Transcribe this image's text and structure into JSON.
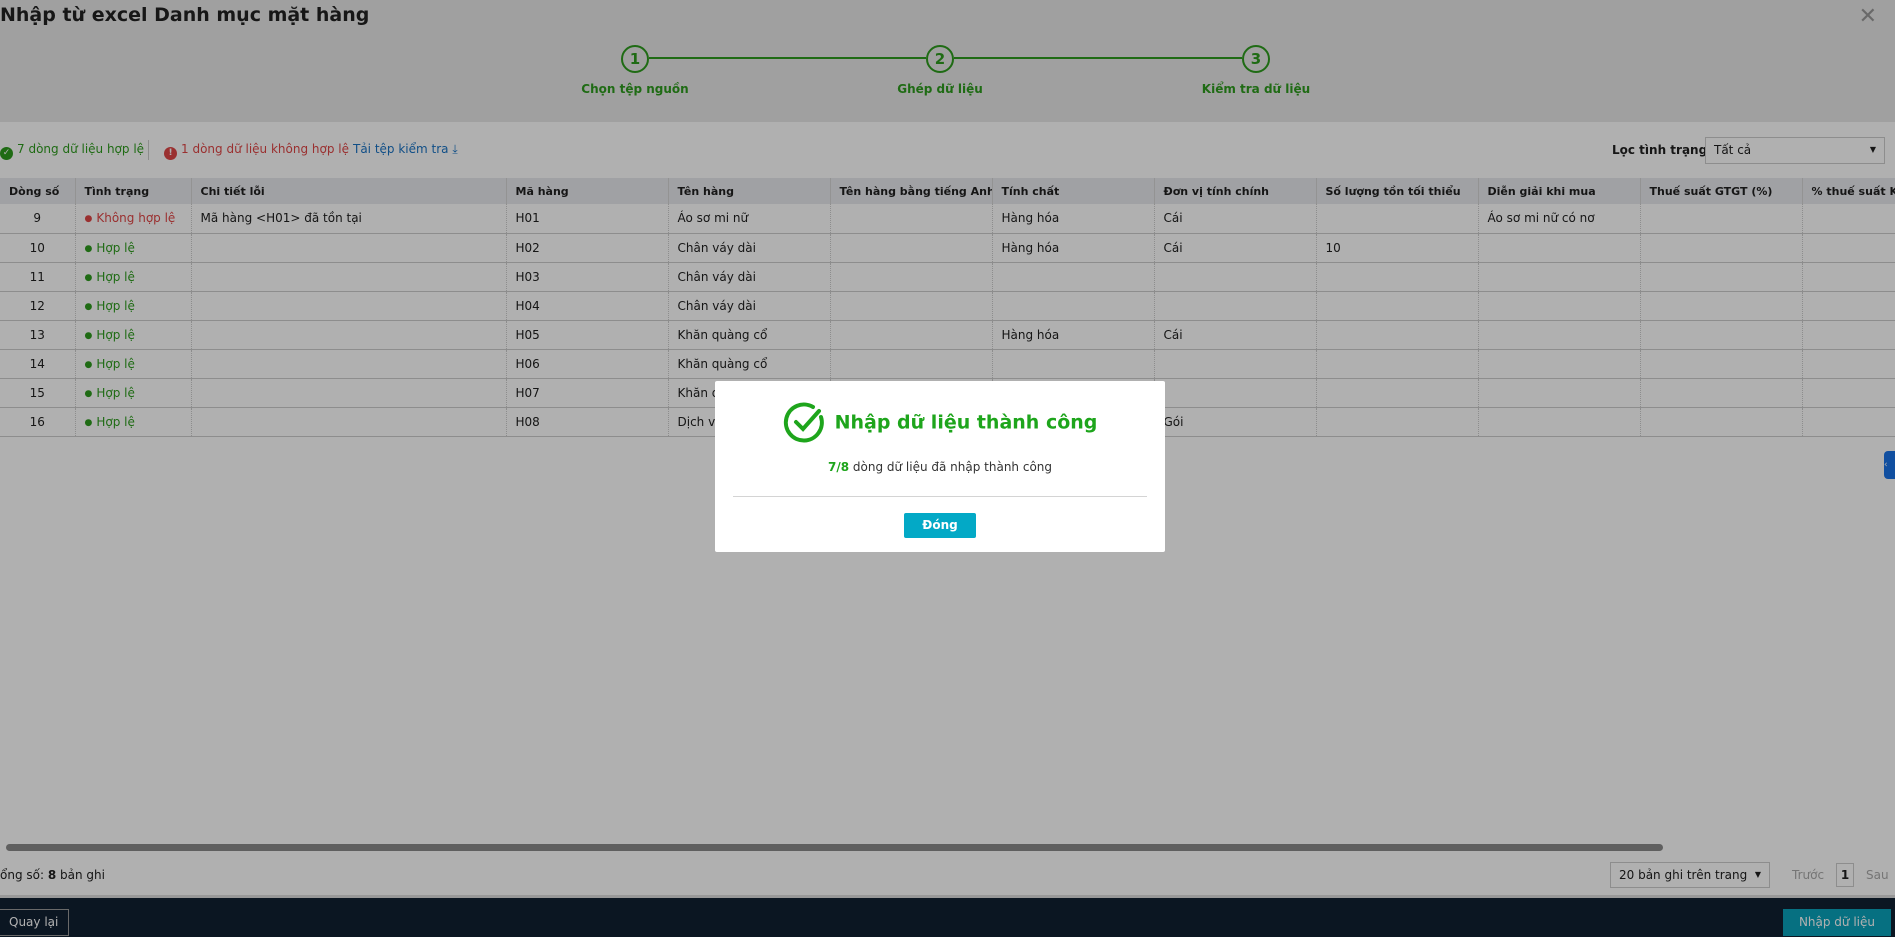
{
  "dialog_title": "Nhập từ excel Danh mục mặt hàng",
  "steps": [
    {
      "number": "1",
      "label": "Chọn tệp nguồn"
    },
    {
      "number": "2",
      "label": "Ghép dữ liệu"
    },
    {
      "number": "3",
      "label": "Kiểm tra dữ liệu"
    }
  ],
  "toolbar": {
    "valid_text": "7 dòng dữ liệu hợp lệ",
    "invalid_text": "1 dòng dữ liệu không hợp lệ",
    "download_text": "Tải tệp kiểm tra",
    "filter_label": "Lọc tình trạng",
    "filter_value": "Tất cả"
  },
  "table": {
    "headers": [
      "Dòng số",
      "Tình trạng",
      "Chi tiết lỗi",
      "Mã hàng",
      "Tên hàng",
      "Tên hàng bằng tiếng Anh",
      "Tính chất",
      "Đơn vị tính chính",
      "Số lượng tồn tối thiểu",
      "Diễn giải khi mua",
      "Thuế suất GTGT (%)",
      "% thuế suất KI"
    ],
    "rows": [
      {
        "line": "9",
        "status": "Không hợp lệ",
        "error": "Mã hàng <H01> đã tồn tại",
        "code": "H01",
        "name": "Áo sơ mi nữ",
        "name_en": "",
        "nature": "Hàng hóa",
        "unit": "Cái",
        "min_qty": "",
        "purchase_desc": "Áo sơ mi nữ có nơ",
        "vat": "",
        "tax2": ""
      },
      {
        "line": "10",
        "status": "Hợp lệ",
        "error": "",
        "code": "H02",
        "name": "Chân váy dài",
        "name_en": "",
        "nature": "Hàng hóa",
        "unit": "Cái",
        "min_qty": "10",
        "purchase_desc": "",
        "vat": "",
        "tax2": ""
      },
      {
        "line": "11",
        "status": "Hợp lệ",
        "error": "",
        "code": "H03",
        "name": "Chân váy dài",
        "name_en": "",
        "nature": "",
        "unit": "",
        "min_qty": "",
        "purchase_desc": "",
        "vat": "",
        "tax2": ""
      },
      {
        "line": "12",
        "status": "Hợp lệ",
        "error": "",
        "code": "H04",
        "name": "Chân váy dài",
        "name_en": "",
        "nature": "",
        "unit": "",
        "min_qty": "",
        "purchase_desc": "",
        "vat": "",
        "tax2": ""
      },
      {
        "line": "13",
        "status": "Hợp lệ",
        "error": "",
        "code": "H05",
        "name": "Khăn quàng cổ",
        "name_en": "",
        "nature": "Hàng hóa",
        "unit": "Cái",
        "min_qty": "",
        "purchase_desc": "",
        "vat": "",
        "tax2": ""
      },
      {
        "line": "14",
        "status": "Hợp lệ",
        "error": "",
        "code": "H06",
        "name": "Khăn quàng cổ",
        "name_en": "",
        "nature": "",
        "unit": "",
        "min_qty": "",
        "purchase_desc": "",
        "vat": "",
        "tax2": ""
      },
      {
        "line": "15",
        "status": "Hợp lệ",
        "error": "",
        "code": "H07",
        "name": "Khăn q",
        "name_en": "",
        "nature": "",
        "unit": "",
        "min_qty": "",
        "purchase_desc": "",
        "vat": "",
        "tax2": ""
      },
      {
        "line": "16",
        "status": "Hợp lệ",
        "error": "",
        "code": "H08",
        "name": "Dịch vụ",
        "name_en": "",
        "nature": "",
        "unit": "Gói",
        "min_qty": "",
        "purchase_desc": "",
        "vat": "",
        "tax2": ""
      }
    ]
  },
  "footer": {
    "total_label": "ổng số: ",
    "total_count": "8",
    "total_suffix": " bản ghi",
    "page_size": "20 bản ghi trên trang",
    "prev": "Trước",
    "page": "1",
    "next": "Sau"
  },
  "bottom": {
    "back": "Quay lại",
    "import": "Nhập dữ liệu"
  },
  "modal": {
    "title": "Nhập dữ liệu thành công",
    "count": "7/8",
    "message": " dòng dữ liệu đã nhập thành công",
    "close": "Đóng"
  },
  "colors": {
    "success": "#1ea51c",
    "error": "#e04646",
    "primary": "#03a9c6",
    "bottom_bar": "#112032"
  }
}
